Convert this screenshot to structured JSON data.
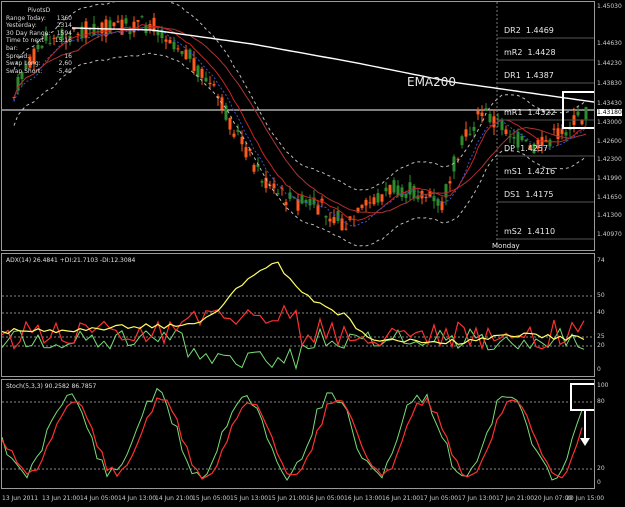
{
  "pivot_box": {
    "title": "PivotsD",
    "rows": [
      {
        "label": "Range Today:",
        "value": "1360"
      },
      {
        "label": "Yesterday:",
        "value": "2314"
      },
      {
        "label": "30 Day Range:",
        "value": "1594"
      },
      {
        "label": "Time to next bar:",
        "value": "15:16"
      },
      {
        "label": "Spread:",
        "value": "16"
      },
      {
        "label": "Swap Long:",
        "value": "2,60"
      },
      {
        "label": "Swap Short:",
        "value": "-5,40"
      }
    ]
  },
  "price_panel": {
    "ema_label": "EMA200",
    "levels": [
      {
        "name": "DR2",
        "value": "1.4469"
      },
      {
        "name": "mR2",
        "value": "1.4428"
      },
      {
        "name": "DR1",
        "value": "1.4387"
      },
      {
        "name": "mR1",
        "value": "1.4322"
      },
      {
        "name": "DP",
        "value": "1.4257"
      },
      {
        "name": "mS1",
        "value": "1.4216"
      },
      {
        "name": "DS1",
        "value": "1.4175"
      },
      {
        "name": "mS2",
        "value": "1.4110"
      }
    ],
    "session_label": "Monday",
    "axis": [
      "1.45030",
      "1.44630",
      "1.44230",
      "1.43830",
      "1.43430",
      "1.43180",
      "1.43000",
      "1.42600",
      "1.42300",
      "1.41990",
      "1.41650",
      "1.41300",
      "1.40970"
    ]
  },
  "adx_panel": {
    "title": "ADX(14) 26.4841 +DI:21.7103 -DI:12.3084",
    "axis": [
      "74",
      "50",
      "40",
      "25",
      "20",
      "0"
    ]
  },
  "stoch_panel": {
    "title": "Stoch(5,3,3) 90.2582 86.7857",
    "axis": [
      "100",
      "80",
      "20",
      "0"
    ]
  },
  "time_axis": [
    "13 Jun 2011",
    "13 Jun 21:00",
    "14 Jun 05:00",
    "14 Jun 13:00",
    "14 Jun 21:00",
    "15 Jun 05:00",
    "15 Jun 13:00",
    "15 Jun 21:00",
    "16 Jun 05:00",
    "16 Jun 13:00",
    "16 Jun 21:00",
    "17 Jun 05:00",
    "17 Jun 13:00",
    "17 Jun 21:00",
    "20 Jun 07:00",
    "20 Jun 15:00"
  ],
  "colors": {
    "bull": "#2e8b2e",
    "bear": "#ff5a1e",
    "ema": "#ffffff",
    "adx": "#ffff66",
    "plus_di": "#77dd77",
    "minus_di": "#ff3030"
  }
}
